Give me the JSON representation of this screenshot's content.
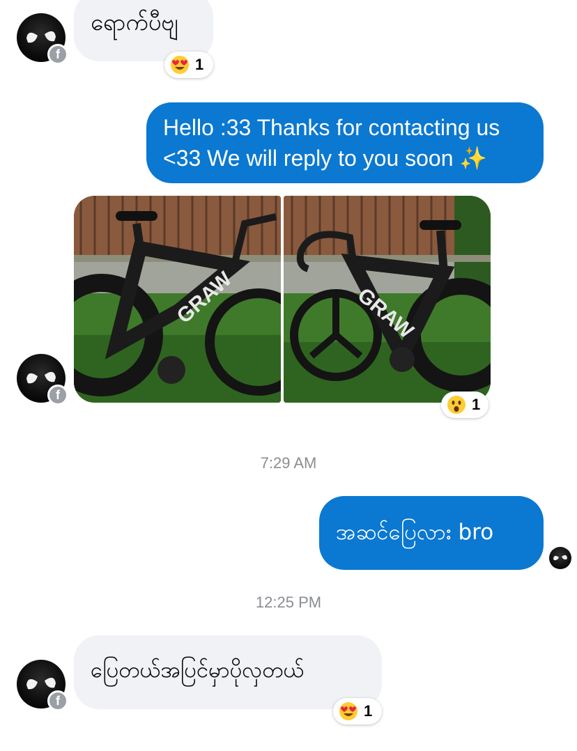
{
  "messages": [
    {
      "text": "ရောက်ပီဗျ",
      "reaction": {
        "emoji": "heart-eyes",
        "count": "1"
      }
    },
    {
      "text": "Hello :33 Thanks for contacting us <33 We will reply to you soon ✨"
    },
    {
      "photos": [
        "bike-photo-1",
        "bike-photo-2"
      ],
      "reaction": {
        "emoji": "surprised",
        "count": "1"
      }
    },
    {
      "text": "အဆင်ပြေလား bro"
    },
    {
      "text": "ပြေတယ်အပြင်မှာပိုလှတယ်",
      "reaction": {
        "emoji": "heart-eyes",
        "count": "1"
      }
    }
  ],
  "timestamps": [
    "7:29 AM",
    "12:25 PM"
  ],
  "outgoing_line1": "Hello :33 Thanks for contacting us",
  "outgoing_line2": "<33 We will reply to you soon ✨",
  "colors": {
    "outgoing_bubble": "#0b78d1",
    "incoming_bubble": "#f0f2f5",
    "timestamp": "#8a8d91"
  },
  "badge_label": "f",
  "icons": [
    "facebook-badge-icon",
    "heart-eyes-emoji-icon",
    "surprised-emoji-icon"
  ]
}
